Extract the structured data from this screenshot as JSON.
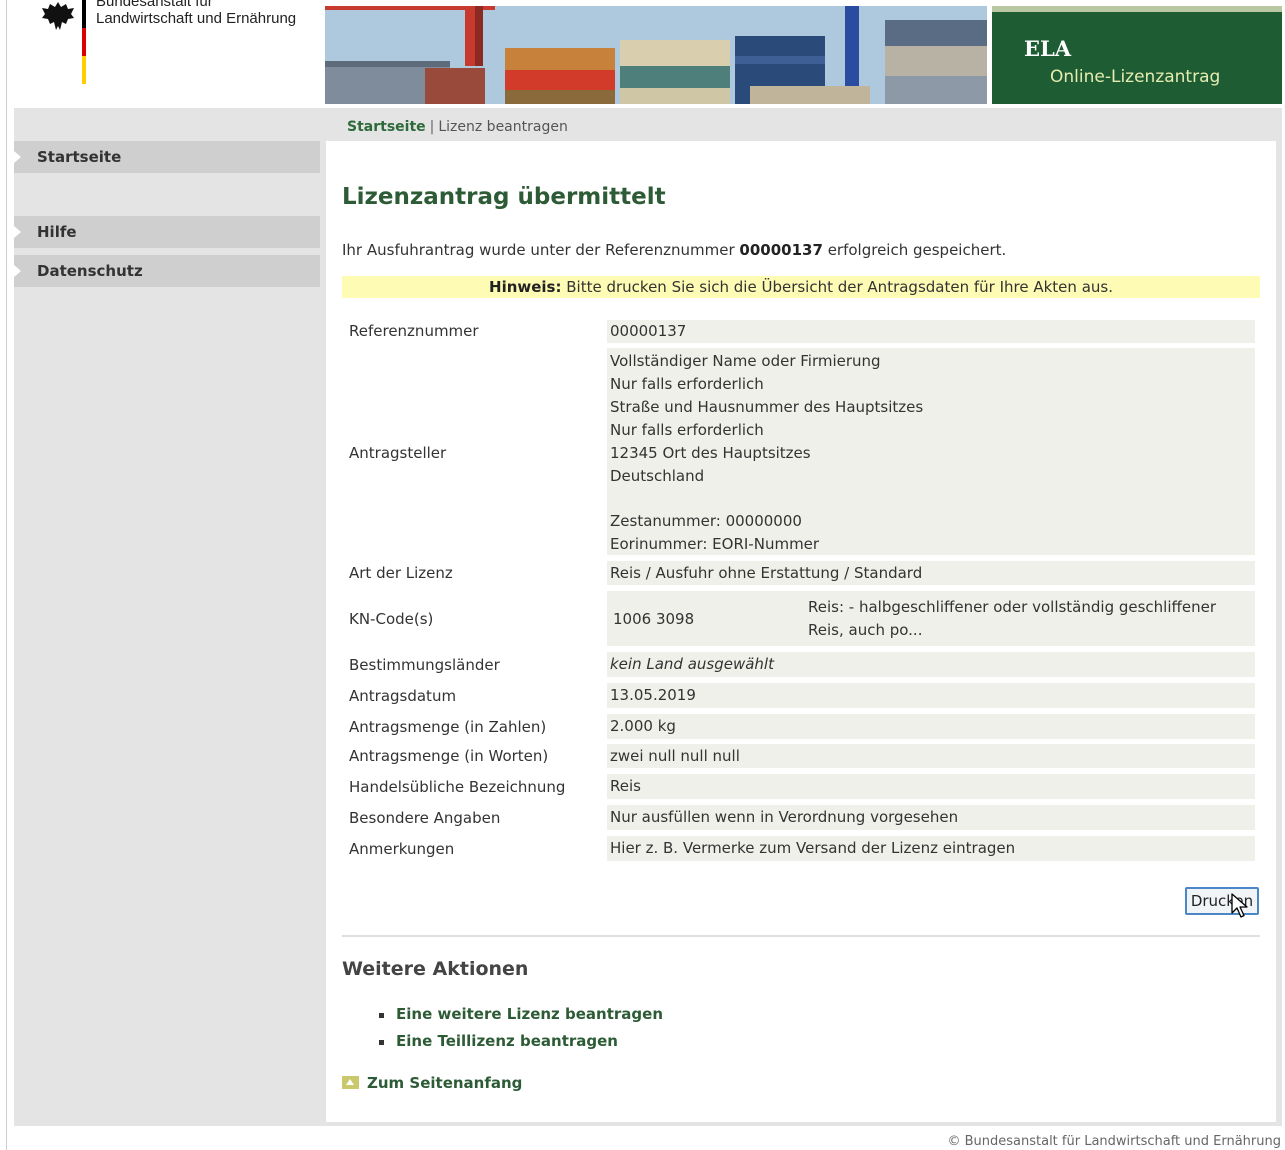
{
  "header": {
    "logo_line1": "Bundesanstalt für",
    "logo_line2": "Landwirtschaft und Ernährung",
    "app_title": "ELA",
    "app_subtitle": "Online-Lizenzantrag",
    "flag_colors": [
      "#000000",
      "#dd0000",
      "#ffce00"
    ]
  },
  "breadcrumb": {
    "home": "Startseite",
    "separator": "|",
    "current": "Lizenz beantragen"
  },
  "nav": {
    "items": [
      {
        "label": "Startseite"
      },
      {
        "label": "Hilfe"
      },
      {
        "label": "Datenschutz"
      }
    ]
  },
  "main": {
    "title": "Lizenzantrag übermittelt",
    "intro_before": "Ihr Ausfuhrantrag wurde unter der Referenznummer ",
    "intro_ref": "00000137",
    "intro_after": " erfolgreich gespeichert.",
    "hint_label": "Hinweis:",
    "hint_text": " Bitte drucken Sie sich die Übersicht der Antragsdaten für Ihre Akten aus."
  },
  "details": {
    "referenznummer": {
      "label": "Referenznummer",
      "value": "00000137"
    },
    "antragsteller": {
      "label": "Antragsteller",
      "lines": [
        "Vollständiger Name oder Firmierung",
        "Nur falls erforderlich",
        "Straße und Hausnummer des Hauptsitzes",
        "Nur falls erforderlich",
        "12345 Ort des Hauptsitzes",
        "Deutschland",
        "",
        "Zestanummer: 00000000",
        "Eorinummer: EORI-Nummer"
      ]
    },
    "art": {
      "label": "Art der Lizenz",
      "value": "Reis / Ausfuhr ohne Erstattung / Standard"
    },
    "kn": {
      "label": "KN-Code(s)",
      "code": "1006 3098",
      "desc_line1": "Reis: - halbgeschliffener oder vollständig geschliffener",
      "desc_line2": "Reis, auch po..."
    },
    "laender": {
      "label": "Bestimmungsländer",
      "value": "kein Land ausgewählt"
    },
    "datum": {
      "label": "Antragsdatum",
      "value": "13.05.2019"
    },
    "menge_zahlen": {
      "label": "Antragsmenge (in Zahlen)",
      "value": "2.000 kg"
    },
    "menge_worten": {
      "label": "Antragsmenge (in Worten)",
      "value": "zwei null null null"
    },
    "bezeichnung": {
      "label": "Handelsübliche Bezeichnung",
      "value": "Reis"
    },
    "besondere": {
      "label": "Besondere Angaben",
      "value": "Nur ausfüllen wenn in Verordnung vorgesehen"
    },
    "anmerkungen": {
      "label": "Anmerkungen",
      "value": "Hier z. B. Vermerke zum Versand der Lizenz eintragen"
    }
  },
  "actions": {
    "print_label": "Drucken",
    "section_title": "Weitere Aktionen",
    "links": [
      {
        "label": "Eine weitere Lizenz beantragen"
      },
      {
        "label": "Eine Teillizenz beantragen"
      }
    ],
    "top_link": "Zum Seitenanfang"
  },
  "footer": {
    "text": "© Bundesanstalt für Landwirtschaft und Ernährung"
  }
}
